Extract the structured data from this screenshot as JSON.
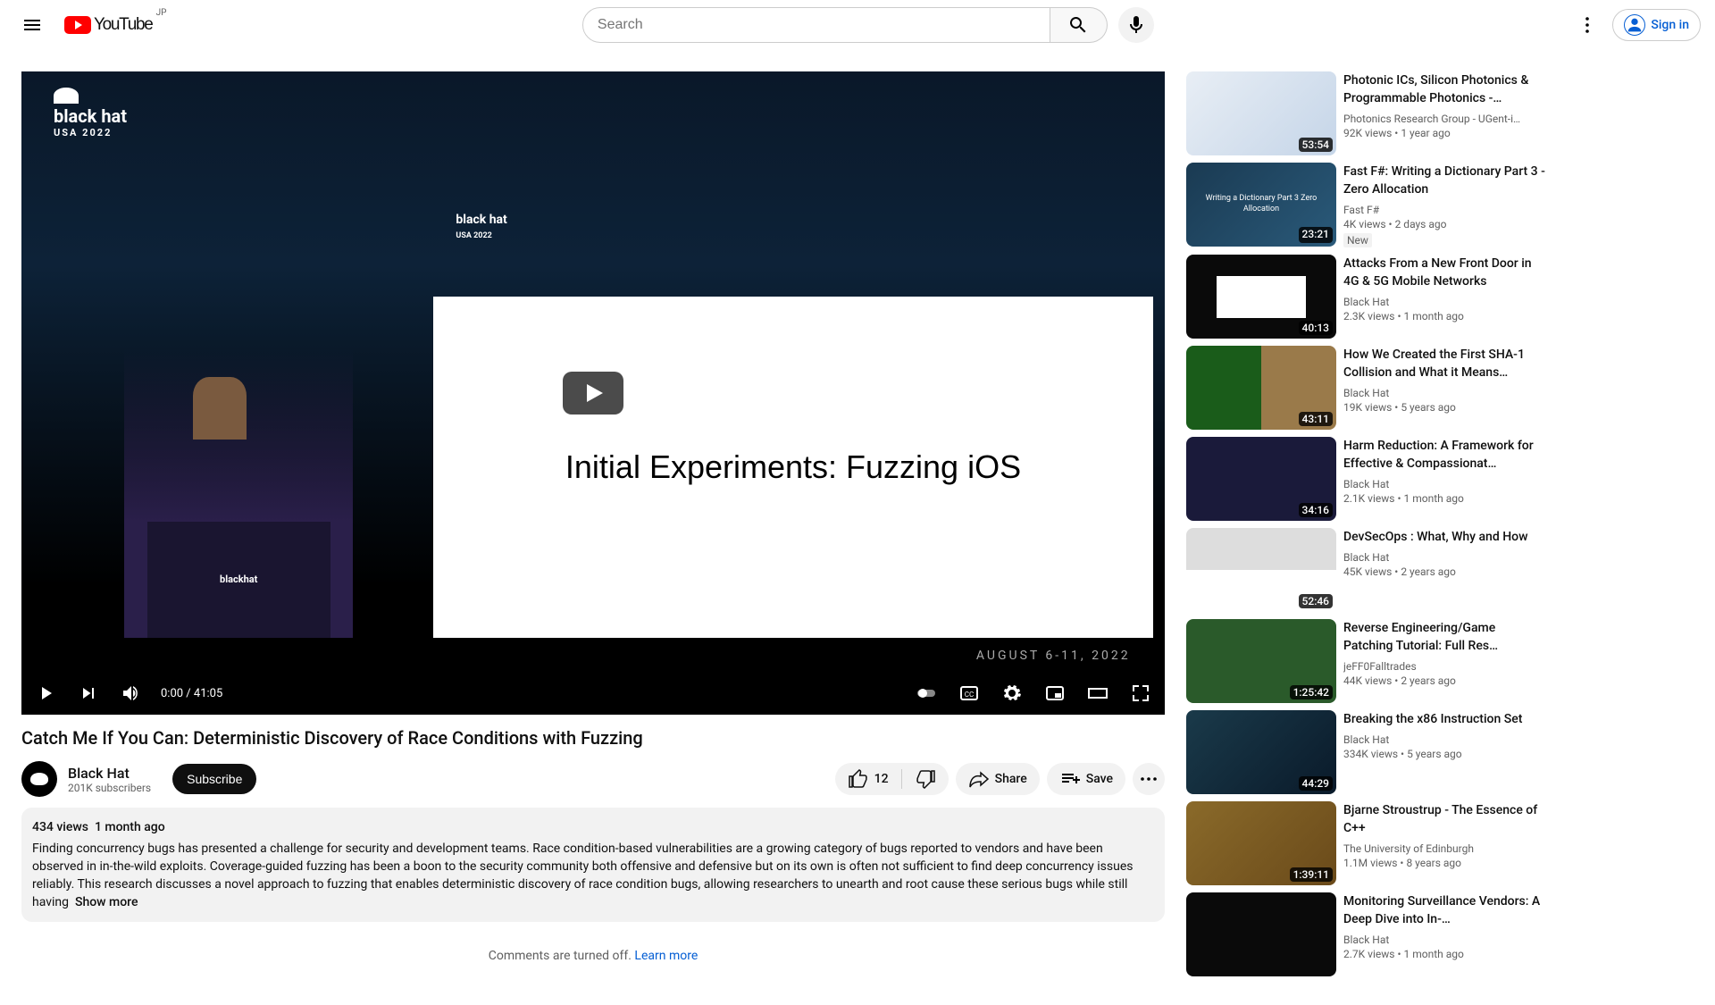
{
  "header": {
    "logo_text": "YouTube",
    "country": "JP",
    "search_placeholder": "Search",
    "signin_label": "Sign in"
  },
  "video": {
    "title": "Catch Me If You Can: Deterministic Discovery of Race Conditions with Fuzzing",
    "slide_text": "Initial Experiments: Fuzzing iOS",
    "event_logo": "black hat",
    "event_sub": "USA 2022",
    "event_date": "AUGUST 6-11, 2022",
    "current_time": "0:00",
    "total_time": "41:05"
  },
  "channel": {
    "name": "Black Hat",
    "subs": "201K subscribers",
    "subscribe_label": "Subscribe"
  },
  "actions": {
    "like_count": "12",
    "share_label": "Share",
    "save_label": "Save"
  },
  "description": {
    "views": "434 views",
    "date": "1 month ago",
    "body": "Finding concurrency bugs has presented a challenge for security and development teams. Race condition-based vulnerabilities are a growing category of bugs reported to vendors and have been observed in in-the-wild exploits. Coverage-guided fuzzing has been a boon to the security community both offensive and defensive but on its own is often not sufficient to find deep concurrency issues reliably. This research discusses a novel approach to fuzzing that enables deterministic discovery of race condition bugs, allowing researchers to unearth and root cause these serious bugs while still having",
    "show_more": "Show more"
  },
  "comments": {
    "text": "Comments are turned off.",
    "link": "Learn more"
  },
  "recommendations": [
    {
      "title": "Photonic ICs, Silicon Photonics & Programmable Photonics -…",
      "channel": "Photonics Research Group - UGent-i…",
      "views": "92K views",
      "age": "1 year ago",
      "duration": "53:54",
      "bg": "thumb-bg1"
    },
    {
      "title": "Fast F#: Writing a Dictionary Part 3 - Zero Allocation",
      "channel": "Fast F#",
      "views": "4K views",
      "age": "2 days ago",
      "duration": "23:21",
      "badge": "New",
      "bg": "thumb-bg2",
      "thumb_text": "Writing a Dictionary\nPart 3\nZero Allocation"
    },
    {
      "title": "Attacks From a New Front Door in 4G & 5G Mobile Networks",
      "channel": "Black Hat",
      "views": "2.3K views",
      "age": "1 month ago",
      "duration": "40:13",
      "bg": "thumb-bg3"
    },
    {
      "title": "How We Created the First SHA-1 Collision and What it Means…",
      "channel": "Black Hat",
      "views": "19K views",
      "age": "5 years ago",
      "duration": "43:11",
      "bg": "thumb-bg4"
    },
    {
      "title": "Harm Reduction: A Framework for Effective & Compassionat…",
      "channel": "Black Hat",
      "views": "2.1K views",
      "age": "1 month ago",
      "duration": "34:16",
      "bg": "thumb-bg5"
    },
    {
      "title": "DevSecOps : What, Why and How",
      "channel": "Black Hat",
      "views": "45K views",
      "age": "2 years ago",
      "duration": "52:46",
      "bg": "thumb-bg6"
    },
    {
      "title": "Reverse Engineering/Game Patching Tutorial: Full Res…",
      "channel": "jeFF0Falltrades",
      "views": "44K views",
      "age": "2 years ago",
      "duration": "1:25:42",
      "bg": "thumb-bg7"
    },
    {
      "title": "Breaking the x86 Instruction Set",
      "channel": "Black Hat",
      "views": "334K views",
      "age": "5 years ago",
      "duration": "44:29",
      "bg": "thumb-bg8"
    },
    {
      "title": "Bjarne Stroustrup - The Essence of C++",
      "channel": "The University of Edinburgh",
      "views": "1.1M views",
      "age": "8 years ago",
      "duration": "1:39:11",
      "bg": "thumb-bg9"
    },
    {
      "title": "Monitoring Surveillance Vendors: A Deep Dive into In-…",
      "channel": "Black Hat",
      "views": "2.7K views",
      "age": "1 month ago",
      "duration": "",
      "bg": "thumb-bg10"
    }
  ]
}
